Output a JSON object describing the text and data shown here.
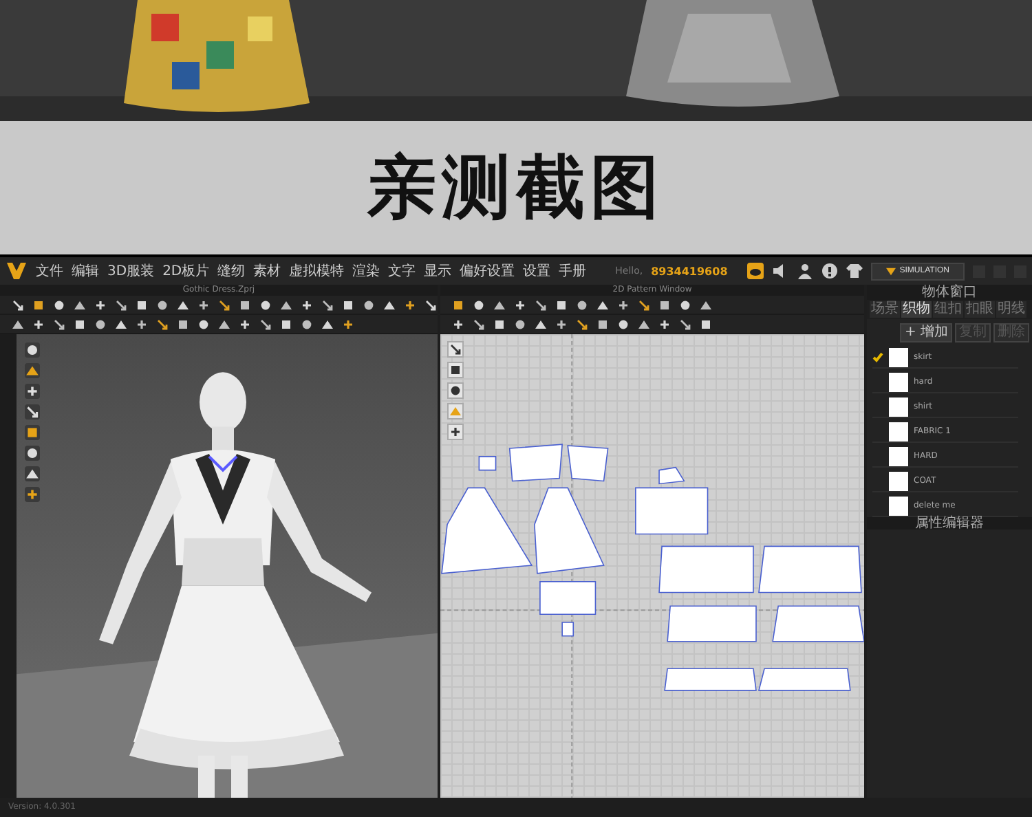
{
  "heading": "亲测截图",
  "app": {
    "menu": [
      "文件",
      "编辑",
      "3D服装",
      "2D板片",
      "缝纫",
      "素材",
      "虚拟模特",
      "渲染",
      "文字",
      "显示",
      "偏好设置",
      "设置",
      "手册"
    ],
    "account": {
      "greeting": "Hello,",
      "id": "8934419608"
    },
    "mode_button": "SIMULATION",
    "view_3d": {
      "title": "Gothic Dress.Zprj"
    },
    "view_2d": {
      "title": "2D Pattern Window"
    },
    "object_window": {
      "title": "物体窗口",
      "tabs": [
        {
          "label": "场景",
          "selected": false
        },
        {
          "label": "织物",
          "selected": true
        },
        {
          "label": "纽扣",
          "selected": false
        },
        {
          "label": "扣眼",
          "selected": false
        },
        {
          "label": "明线",
          "selected": false
        }
      ],
      "buttons": [
        {
          "label": "+ 增加",
          "disabled": false
        },
        {
          "label": "复制",
          "disabled": true
        },
        {
          "label": "删除",
          "disabled": true
        }
      ],
      "fabrics": [
        {
          "name": "skirt",
          "checked": true
        },
        {
          "name": "hard",
          "checked": false
        },
        {
          "name": "shirt",
          "checked": false
        },
        {
          "name": "FABRIC 1",
          "checked": false
        },
        {
          "name": "HARD",
          "checked": false
        },
        {
          "name": "COAT",
          "checked": false
        },
        {
          "name": "delete me",
          "checked": false
        }
      ]
    },
    "property_editor": {
      "title": "属性编辑器"
    },
    "status": "Version: 4.0.301"
  }
}
